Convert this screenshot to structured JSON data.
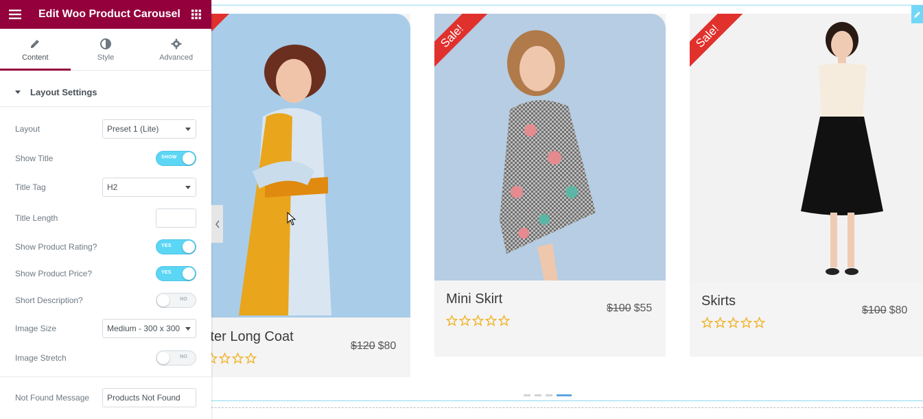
{
  "panel": {
    "title": "Edit Woo Product Carousel",
    "tabs": [
      {
        "label": "Content",
        "icon": "pencil-icon"
      },
      {
        "label": "Style",
        "icon": "half-circle-icon"
      },
      {
        "label": "Advanced",
        "icon": "gear-icon"
      }
    ],
    "section_title": "Layout Settings",
    "controls": {
      "layout": {
        "label": "Layout",
        "value": "Preset 1 (Lite)"
      },
      "show_title": {
        "label": "Show Title",
        "state": "SHOW"
      },
      "title_tag": {
        "label": "Title Tag",
        "value": "H2"
      },
      "title_length": {
        "label": "Title Length",
        "value": ""
      },
      "show_rating": {
        "label": "Show Product Rating?",
        "state": "YES"
      },
      "show_price": {
        "label": "Show Product Price?",
        "state": "YES"
      },
      "short_desc": {
        "label": "Short Description?",
        "state": "NO"
      },
      "image_size": {
        "label": "Image Size",
        "value": "Medium - 300 x 300"
      },
      "image_stretch": {
        "label": "Image Stretch",
        "state": "NO"
      },
      "not_found": {
        "label": "Not Found Message",
        "value": "Products Not Found"
      }
    }
  },
  "products": [
    {
      "title": "Winter Long Coat",
      "old_price": "$120",
      "price": "$80",
      "sale": true,
      "image_bg": "#a9cce9"
    },
    {
      "title": "Mini Skirt",
      "old_price": "$100",
      "price": "$55",
      "sale": true,
      "sale_label": "Sale!",
      "image_bg": "#b6cde3"
    },
    {
      "title": "Skirts",
      "old_price": "$100",
      "price": "$80",
      "sale": true,
      "sale_label": "Sale!",
      "image_bg": "#f2f2f2"
    }
  ],
  "carousel": {
    "pages": 4,
    "active_page": 4
  },
  "colors": {
    "brand": "#93003c",
    "toggle_on": "#5cd6f5",
    "sale_ribbon": "#e0312d",
    "star": "#f0b429"
  }
}
